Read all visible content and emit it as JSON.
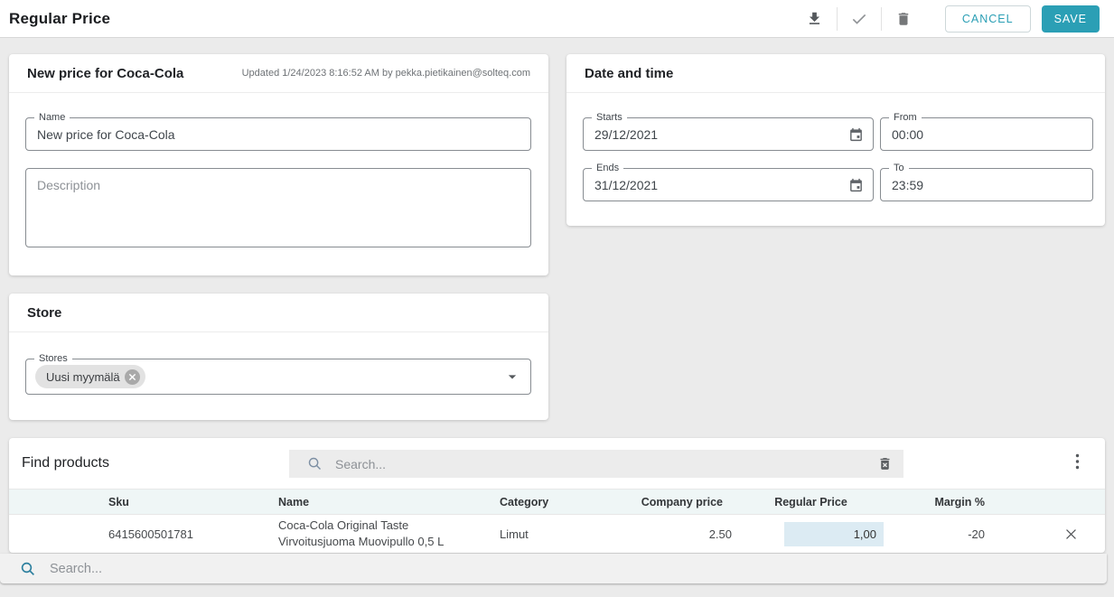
{
  "colors": {
    "accent": "#2b9fb5",
    "regular_price_cell_bg": "#dcebf3",
    "table_header_bg": "#eff6f6"
  },
  "topbar": {
    "title": "Regular Price",
    "cancel_label": "CANCEL",
    "save_label": "SAVE"
  },
  "price_card": {
    "title": "New price for Coca-Cola",
    "updated": "Updated 1/24/2023 8:16:52 AM by pekka.pietikainen@solteq.com",
    "name_label": "Name",
    "name_value": "New price for Coca-Cola",
    "description_placeholder": "Description"
  },
  "datetime_card": {
    "title": "Date and time",
    "starts_label": "Starts",
    "starts_value": "29/12/2021",
    "from_label": "From",
    "from_value": "00:00",
    "ends_label": "Ends",
    "ends_value": "31/12/2021",
    "to_label": "To",
    "to_value": "23:59"
  },
  "store_card": {
    "title": "Store",
    "stores_label": "Stores",
    "chips": [
      {
        "label": "Uusi myymälä"
      }
    ]
  },
  "products_card": {
    "title": "Find products",
    "search_placeholder": "Search...",
    "columns": {
      "sku": "Sku",
      "name": "Name",
      "category": "Category",
      "company_price": "Company price",
      "regular_price": "Regular Price",
      "margin": "Margin %"
    },
    "rows": [
      {
        "sku": "6415600501781",
        "name_line1": "Coca-Cola Original Taste",
        "name_line2": "Virvoitusjuoma Muovipullo 0,5 L",
        "category": "Limut",
        "company_price": "2.50",
        "regular_price": "1,00",
        "margin": "-20"
      }
    ]
  },
  "bottom_search": {
    "placeholder": "Search..."
  }
}
